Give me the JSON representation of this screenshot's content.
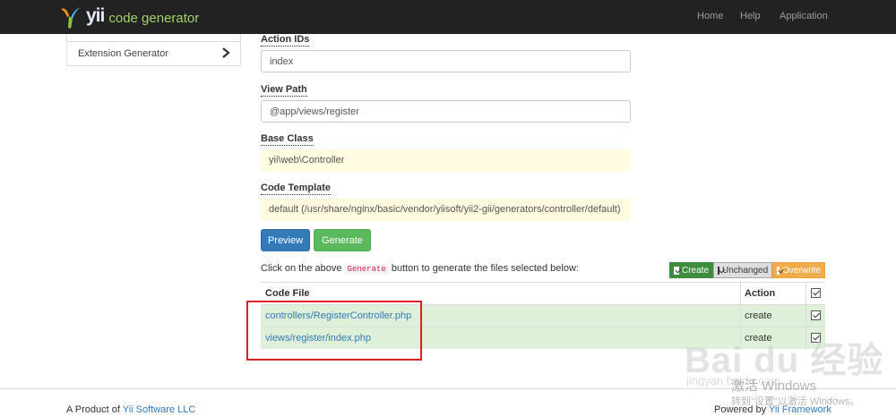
{
  "navbar": {
    "brand_logo_text": "yii",
    "brand_text": "code generator",
    "links": [
      "Home",
      "Help",
      "Application"
    ]
  },
  "sidebar": {
    "items": [
      {
        "label": "Extension Generator"
      }
    ]
  },
  "form": {
    "action_ids": {
      "label": "Action IDs",
      "value": "index"
    },
    "view_path": {
      "label": "View Path",
      "value": "@app/views/register"
    },
    "base_class": {
      "label": "Base Class",
      "value": "yii\\web\\Controller"
    },
    "code_template": {
      "label": "Code Template",
      "value": "default (/usr/share/nginx/basic/vendor/yiisoft/yii2-gii/generators/controller/default)"
    },
    "preview_label": "Preview",
    "generate_label": "Generate"
  },
  "hint": {
    "before": "Click on the above ",
    "code": "Generate",
    "after": " button to generate the files selected below:"
  },
  "legend": {
    "create": "Create",
    "unchanged": "Unchanged",
    "overwrite": "Overwrite"
  },
  "table": {
    "headers": {
      "file": "Code File",
      "action": "Action"
    },
    "rows": [
      {
        "file": "controllers/RegisterController.php",
        "action": "create"
      },
      {
        "file": "views/register/index.php",
        "action": "create"
      }
    ]
  },
  "footer": {
    "left_prefix": "A Product of ",
    "left_link": "Yii Software LLC",
    "right_prefix": "Powered by ",
    "right_link": "Yii Framework"
  },
  "watermark": {
    "activate": "激活 Windows",
    "activate_sub": "转到\"设置\"以激活 Windows。",
    "baidu": "Bai du 经验",
    "url": "jingyan.baidu.com"
  },
  "colors": {
    "navbar": "#222222",
    "primary": "#337ab7",
    "success": "#5cb85c",
    "row_bg": "#dff0d8",
    "highlight": "#e02020"
  }
}
